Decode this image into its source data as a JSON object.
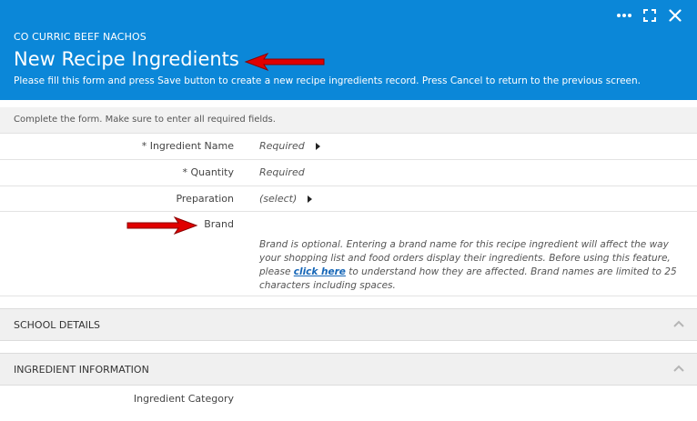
{
  "header": {
    "subtitle": "CO CURRIC BEEF NACHOS",
    "title": "New Recipe Ingredients",
    "description": "Please fill this form and press Save button to create a new recipe ingredients record. Press Cancel to return to the previous screen.",
    "background_color": "#0b87d8",
    "icons": [
      "more-icon",
      "expand-icon",
      "close-icon"
    ]
  },
  "form": {
    "instruction": "Complete the form. Make sure to enter all required fields.",
    "fields": [
      {
        "label": "* Ingredient Name",
        "value": "Required"
      },
      {
        "label": "* Quantity",
        "value": "Required"
      },
      {
        "label": "Preparation",
        "value": "(select)"
      },
      {
        "label": "Brand",
        "value": ""
      }
    ],
    "brand_help": {
      "before": "Brand is optional. Entering a brand name for this recipe ingredient will affect the way your shopping list and food orders display their ingredients. Before using this feature, please ",
      "link": "click here",
      "after": " to understand how they are affected. Brand names are limited to 25 characters including spaces."
    }
  },
  "sections": [
    {
      "title": "SCHOOL DETAILS"
    },
    {
      "title": "INGREDIENT INFORMATION"
    }
  ],
  "ingredient_info": {
    "category_label": "Ingredient Category"
  },
  "annotation_color": "#e00000"
}
